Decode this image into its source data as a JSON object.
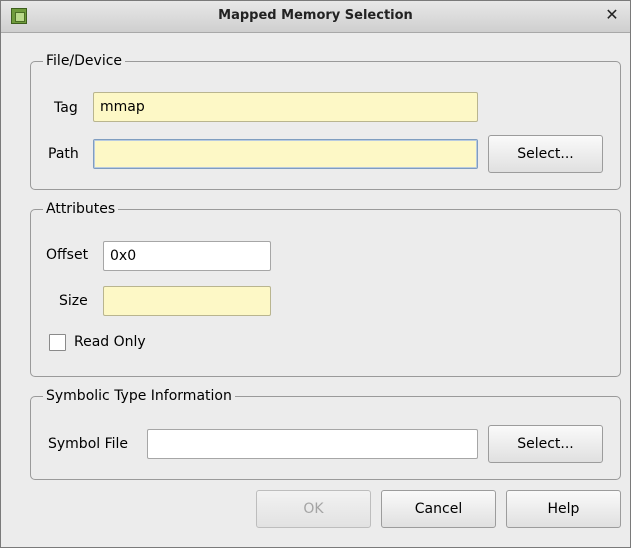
{
  "window": {
    "title": "Mapped Memory Selection",
    "close_glyph": "✕"
  },
  "file_device": {
    "legend": "File/Device",
    "tag_label": "Tag",
    "tag_value": "mmap",
    "path_label": "Path",
    "path_value": "",
    "select_label": "Select..."
  },
  "attributes": {
    "legend": "Attributes",
    "offset_label": "Offset",
    "offset_value": "0x0",
    "size_label": "Size",
    "size_value": "",
    "read_only_label": "Read Only",
    "read_only_checked": false
  },
  "symbolic": {
    "legend": "Symbolic Type Information",
    "symbol_file_label": "Symbol File",
    "symbol_file_value": "",
    "select_label": "Select..."
  },
  "buttons": {
    "ok": "OK",
    "cancel": "Cancel",
    "help": "Help"
  },
  "colors": {
    "required_field": "#fdf8c6",
    "window_bg": "#ececec"
  }
}
